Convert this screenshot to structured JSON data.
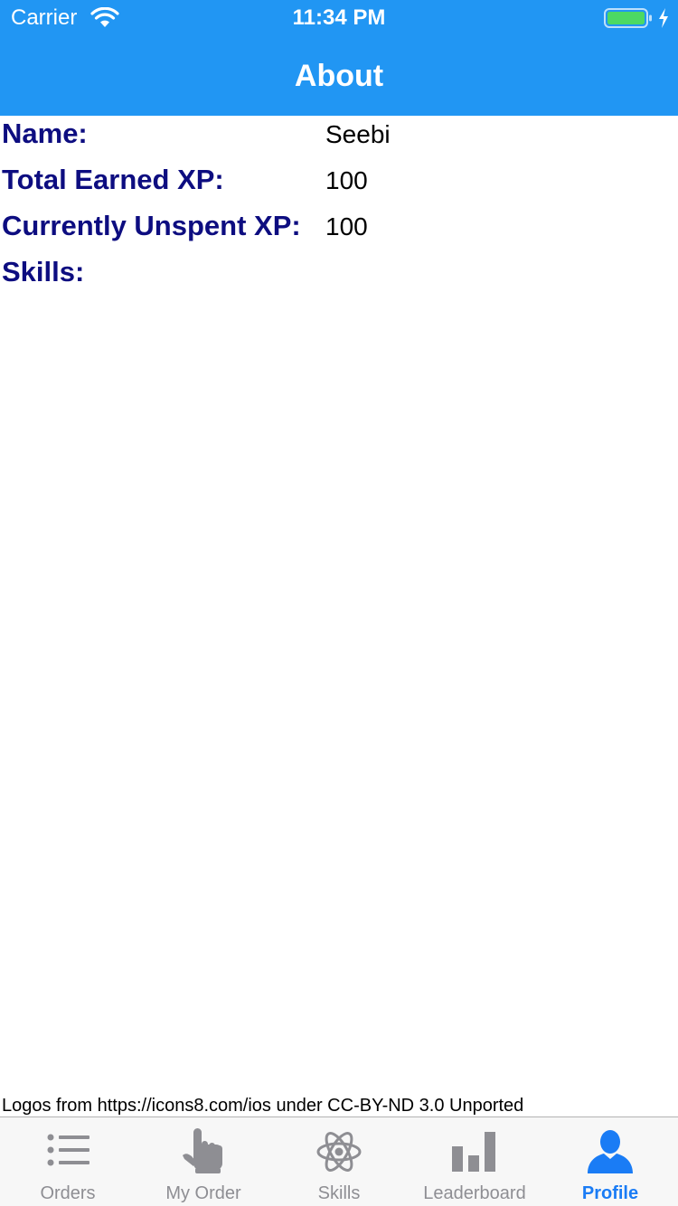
{
  "status_bar": {
    "carrier": "Carrier",
    "time": "11:34 PM"
  },
  "nav": {
    "title": "About"
  },
  "profile": {
    "name_label": "Name:",
    "name_value": "Seebi",
    "total_xp_label": "Total Earned XP:",
    "total_xp_value": "100",
    "unspent_xp_label": "Currently Unspent XP:",
    "unspent_xp_value": "100",
    "skills_label": "Skills:"
  },
  "credit": "Logos from https://icons8.com/ios under CC-BY-ND 3.0 Unported",
  "tabs": [
    {
      "label": "Orders",
      "icon": "list-icon",
      "active": false
    },
    {
      "label": "My Order",
      "icon": "pointing-hand-icon",
      "active": false
    },
    {
      "label": "Skills",
      "icon": "atom-icon",
      "active": false
    },
    {
      "label": "Leaderboard",
      "icon": "bar-chart-icon",
      "active": false
    },
    {
      "label": "Profile",
      "icon": "user-icon",
      "active": true
    }
  ],
  "colors": {
    "header": "#2196f3",
    "label_text": "#0d0d80",
    "tab_active": "#1a7cf5",
    "tab_inactive": "#8e8e93",
    "battery": "#4cd964"
  }
}
